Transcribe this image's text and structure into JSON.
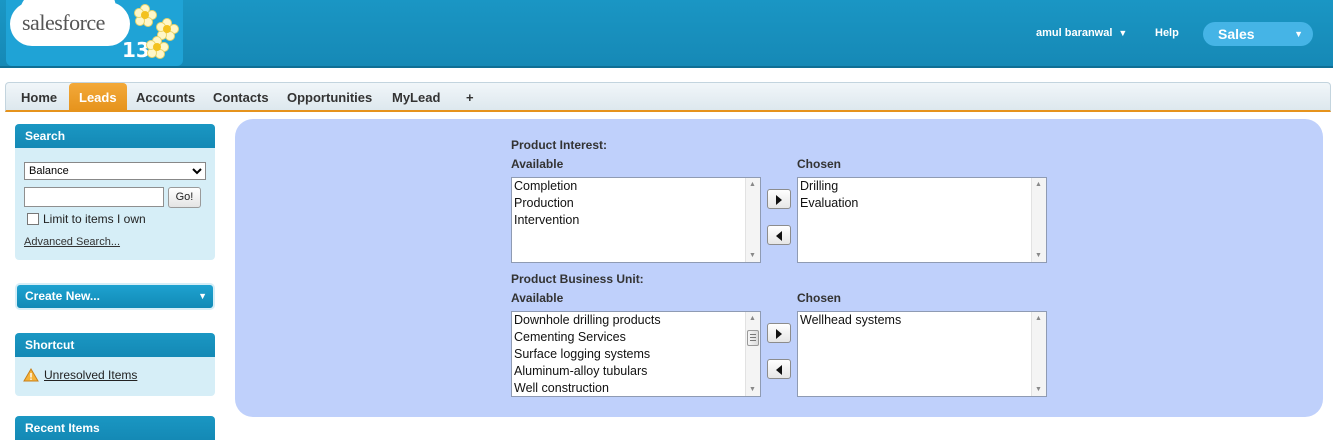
{
  "header": {
    "logo_text": "salesforce",
    "logo_version": "13",
    "user_name": "amul baranwal",
    "help_label": "Help",
    "app_name": "Sales"
  },
  "tabs": [
    {
      "label": "Home",
      "active": false
    },
    {
      "label": "Leads",
      "active": true
    },
    {
      "label": "Accounts",
      "active": false
    },
    {
      "label": "Contacts",
      "active": false
    },
    {
      "label": "Opportunities",
      "active": false
    },
    {
      "label": "MyLead",
      "active": false
    },
    {
      "label": "+",
      "active": false
    }
  ],
  "sidebar": {
    "search": {
      "title": "Search",
      "select_value": "Balance",
      "input_value": "",
      "go_label": "Go!",
      "limit_label": "Limit to items I own",
      "limit_checked": false,
      "advanced_label": "Advanced Search..."
    },
    "create_new_label": "Create New...",
    "shortcut": {
      "title": "Shortcut",
      "item_label": "Unresolved Items",
      "item_icon": "warning-icon"
    },
    "recent_items_title": "Recent Items"
  },
  "main": {
    "product_interest": {
      "title": "Product Interest:",
      "available_label": "Available",
      "chosen_label": "Chosen",
      "available": [
        "Completion",
        "Production",
        "Intervention"
      ],
      "chosen": [
        "Drilling",
        "Evaluation"
      ]
    },
    "product_business_unit": {
      "title": "Product Business Unit:",
      "available_label": "Available",
      "chosen_label": "Chosen",
      "available": [
        "Downhole drilling products",
        "Cementing Services",
        "Surface logging systems",
        "Aluminum-alloy tubulars",
        "Well construction"
      ],
      "chosen": [
        "Wellhead systems"
      ]
    }
  },
  "colors": {
    "header_blue": "#1a96c4",
    "active_tab_orange": "#e6931c",
    "panel_background": "#bfd0fb",
    "sidebar_box": "#d6eef7"
  }
}
